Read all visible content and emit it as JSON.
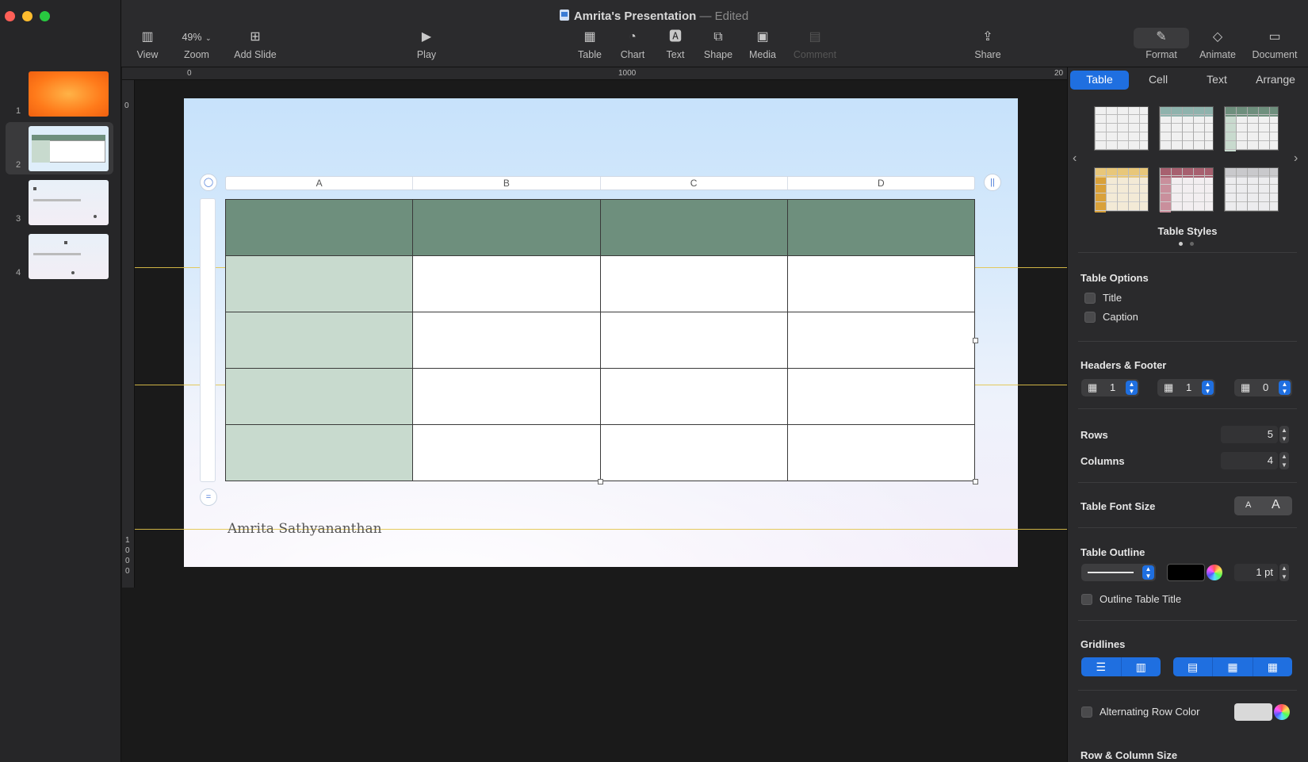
{
  "window": {
    "title": "Amrita's Presentation",
    "title_sep": "—",
    "status": "Edited"
  },
  "toolbar": {
    "view": "View",
    "zoom_value": "49%",
    "zoom": "Zoom",
    "add_slide": "Add Slide",
    "play": "Play",
    "table": "Table",
    "chart": "Chart",
    "text": "Text",
    "shape": "Shape",
    "media": "Media",
    "comment": "Comment",
    "share": "Share",
    "format": "Format",
    "animate": "Animate",
    "document": "Document"
  },
  "navigator": {
    "slides": [
      {
        "number": "1"
      },
      {
        "number": "2"
      },
      {
        "number": "3"
      },
      {
        "number": "4"
      }
    ]
  },
  "rulers": {
    "h_start": "0",
    "h_mid": "1000",
    "h_end": "20",
    "v_start": "0",
    "v_1000": [
      "1",
      "0",
      "0",
      "0"
    ]
  },
  "slide": {
    "columns": [
      "A",
      "B",
      "C",
      "D"
    ],
    "author": "Amrita Sathyananthan",
    "header_color": "#6e8f7d",
    "header_col_color": "#c8dace"
  },
  "inspector": {
    "tabs": [
      "Table",
      "Cell",
      "Text",
      "Arrange"
    ],
    "table_styles_label": "Table Styles",
    "table_options": {
      "title": "Table Options",
      "title_option": "Title",
      "caption_option": "Caption"
    },
    "headers_footer": {
      "title": "Headers & Footer",
      "header_rows": "1",
      "header_columns": "1",
      "footer_rows": "0"
    },
    "rows_label": "Rows",
    "rows_value": "5",
    "columns_label": "Columns",
    "columns_value": "4",
    "font_size_label": "Table Font Size",
    "font_small": "A",
    "font_large": "A",
    "outline": {
      "title": "Table Outline",
      "width": "1 pt",
      "outline_title_label": "Outline Table Title"
    },
    "gridlines_label": "Gridlines",
    "alternating_label": "Alternating Row Color",
    "row_col_size_label": "Row & Column Size",
    "accent": "#1f6fe0"
  }
}
